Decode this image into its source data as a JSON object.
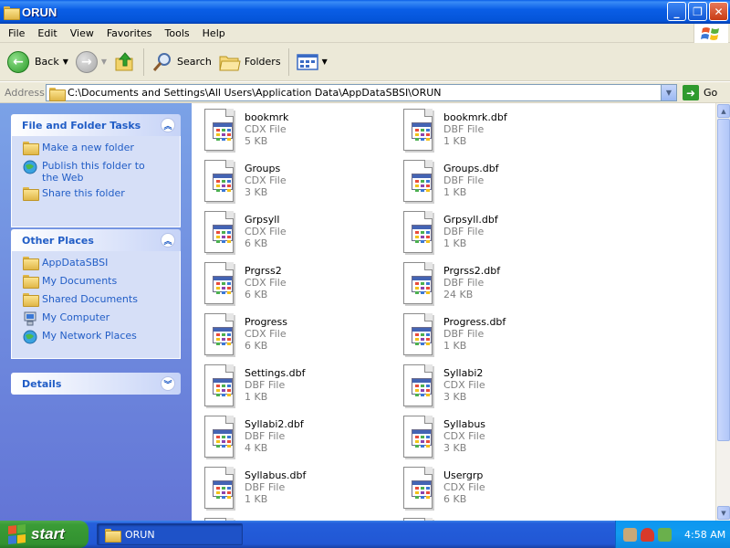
{
  "window": {
    "title": "ORUN"
  },
  "menu": [
    "File",
    "Edit",
    "View",
    "Favorites",
    "Tools",
    "Help"
  ],
  "toolbar": {
    "back": "Back",
    "search": "Search",
    "folders": "Folders"
  },
  "address": {
    "label": "Address",
    "path": "C:\\Documents and Settings\\All Users\\Application Data\\AppDataSBSI\\ORUN",
    "go": "Go"
  },
  "tasks_panel": {
    "title": "File and Folder Tasks",
    "items": [
      {
        "label": "Make a new folder",
        "icon": "new-folder-icon"
      },
      {
        "label": "Publish this folder to the Web",
        "icon": "publish-web-icon"
      },
      {
        "label": "Share this folder",
        "icon": "share-folder-icon"
      }
    ]
  },
  "places_panel": {
    "title": "Other Places",
    "items": [
      {
        "label": "AppDataSBSI",
        "icon": "folder-icon"
      },
      {
        "label": "My Documents",
        "icon": "my-documents-icon"
      },
      {
        "label": "Shared Documents",
        "icon": "shared-documents-icon"
      },
      {
        "label": "My Computer",
        "icon": "my-computer-icon"
      },
      {
        "label": "My Network Places",
        "icon": "network-places-icon"
      }
    ]
  },
  "details_panel": {
    "title": "Details"
  },
  "files": [
    {
      "name": "bookmrk",
      "type": "CDX File",
      "size": "5 KB"
    },
    {
      "name": "bookmrk.dbf",
      "type": "DBF File",
      "size": "1 KB"
    },
    {
      "name": "Groups",
      "type": "CDX File",
      "size": "3 KB"
    },
    {
      "name": "Groups.dbf",
      "type": "DBF File",
      "size": "1 KB"
    },
    {
      "name": "Grpsyll",
      "type": "CDX File",
      "size": "6 KB"
    },
    {
      "name": "Grpsyll.dbf",
      "type": "DBF File",
      "size": "1 KB"
    },
    {
      "name": "Prgrss2",
      "type": "CDX File",
      "size": "6 KB"
    },
    {
      "name": "Prgrss2.dbf",
      "type": "DBF File",
      "size": "24 KB"
    },
    {
      "name": "Progress",
      "type": "CDX File",
      "size": "6 KB"
    },
    {
      "name": "Progress.dbf",
      "type": "DBF File",
      "size": "1 KB"
    },
    {
      "name": "Settings.dbf",
      "type": "DBF File",
      "size": "1 KB"
    },
    {
      "name": "Syllabi2",
      "type": "CDX File",
      "size": "3 KB"
    },
    {
      "name": "Syllabi2.dbf",
      "type": "DBF File",
      "size": "4 KB"
    },
    {
      "name": "Syllabus",
      "type": "CDX File",
      "size": "3 KB"
    },
    {
      "name": "Syllabus.dbf",
      "type": "DBF File",
      "size": "1 KB"
    },
    {
      "name": "Usergrp",
      "type": "CDX File",
      "size": "6 KB"
    }
  ],
  "taskbar": {
    "start": "start",
    "task": "ORUN",
    "clock": "4:58 AM"
  },
  "colors": {
    "title_blue": "#0a5ee6",
    "link_blue": "#215dc6",
    "start_green": "#3a9c36"
  }
}
